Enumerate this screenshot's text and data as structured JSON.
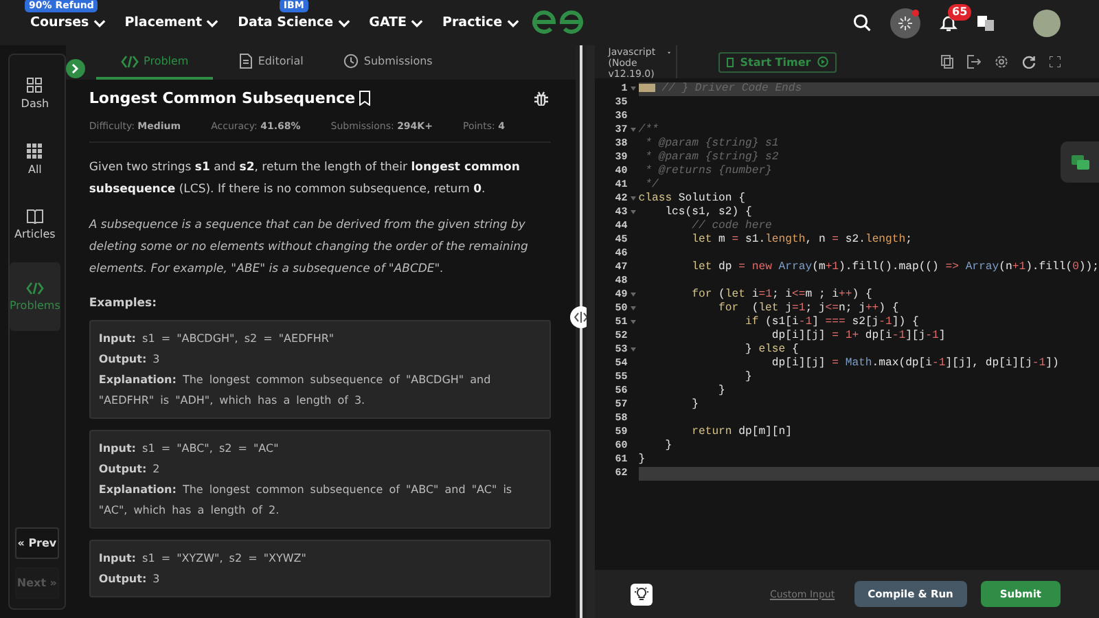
{
  "nav": {
    "items": [
      {
        "label": "Courses",
        "badge": "90% Refund"
      },
      {
        "label": "Placement"
      },
      {
        "label": "Data Science",
        "badge": "IBM"
      },
      {
        "label": "GATE"
      },
      {
        "label": "Practice"
      }
    ],
    "notifications": "65"
  },
  "sidebar": {
    "items": [
      {
        "label": "Dash",
        "kind": "dash",
        "selected": false
      },
      {
        "label": "All",
        "kind": "grid",
        "selected": false
      },
      {
        "label": "Articles",
        "kind": "book",
        "selected": false
      },
      {
        "label": "Problems",
        "kind": "code",
        "selected": true
      }
    ],
    "prev": {
      "label": "« Prev",
      "disabled": false
    },
    "next": {
      "label": "Next »",
      "disabled": true
    }
  },
  "problem_tabs": [
    {
      "label": "Problem",
      "kind": "code",
      "selected": true
    },
    {
      "label": "Editorial",
      "kind": "doc",
      "selected": false
    },
    {
      "label": "Submissions",
      "kind": "clock",
      "selected": false
    }
  ],
  "problem": {
    "title": "Longest Common Subsequence",
    "meta": [
      "Difficulty: **Medium**",
      "Accuracy: **41.68%**",
      "Submissions: **294K+**",
      "Points: **4**"
    ],
    "description": "Given two strings **s1** and **s2**, return the length of their **longest common subsequence** (LCS). If there is no common subsequence, return **0**.",
    "note": "A subsequence is a sequence that can be derived from the given string by deleting some or no elements without changing the order of the remaining elements. For example, \"ABE\" is a subsequence of \"ABCDE\".",
    "examples_heading": "Examples:",
    "examples": [
      {
        "lines": [
          "**Input:** s1 = \"ABCDGH\", s2 = \"AEDFHR\"",
          "**Output:** 3",
          "**Explanation:** The longest common subsequence of \"ABCDGH\" and \"AEDFHR\" is \"ADH\", which has a length of 3."
        ]
      },
      {
        "lines": [
          "**Input:** s1 = \"ABC\", s2 = \"AC\"",
          "**Output:** 2",
          "**Explanation:** The longest common subsequence of \"ABC\" and \"AC\" is \"AC\", which has a length of 2."
        ]
      },
      {
        "lines": [
          "**Input:** s1 = \"XYZW\", s2 = \"XYWZ\"",
          "**Output:** 3"
        ]
      }
    ]
  },
  "editor": {
    "language": "Javascript (Node v12.19.0)",
    "timer_button": "Start Timer",
    "lines": [
      {
        "number": "1",
        "foldable": true,
        "highlighted": true,
        "folded": true,
        "tokens": [
          {
            "kind": "comment",
            "text": " // } Driver Code Ends"
          }
        ]
      },
      {
        "number": "35",
        "foldable": false,
        "highlighted": false
      },
      {
        "number": "36",
        "foldable": false,
        "highlighted": false
      },
      {
        "number": "37",
        "foldable": true,
        "highlighted": false,
        "tokens": [
          {
            "kind": "comment",
            "text": "/**"
          }
        ]
      },
      {
        "number": "38",
        "foldable": false,
        "highlighted": false,
        "tokens": [
          {
            "kind": "comment",
            "text": " * @param {string} s1"
          }
        ]
      },
      {
        "number": "39",
        "foldable": false,
        "highlighted": false,
        "tokens": [
          {
            "kind": "comment",
            "text": " * @param {string} s2"
          }
        ]
      },
      {
        "number": "40",
        "foldable": false,
        "highlighted": false,
        "tokens": [
          {
            "kind": "comment",
            "text": " * @returns {number}"
          }
        ]
      },
      {
        "number": "41",
        "foldable": false,
        "highlighted": false,
        "tokens": [
          {
            "kind": "comment",
            "text": " */"
          }
        ]
      },
      {
        "number": "42",
        "foldable": true,
        "highlighted": false,
        "tokens": [
          {
            "kind": "keyword",
            "text": "class"
          },
          {
            "kind": "plain",
            "text": " Solution {"
          }
        ]
      },
      {
        "number": "43",
        "foldable": true,
        "highlighted": false,
        "tokens": [
          {
            "kind": "plain",
            "text": "    lcs(s1, s2) {"
          }
        ]
      },
      {
        "number": "44",
        "foldable": false,
        "highlighted": false,
        "tokens": [
          {
            "kind": "comment",
            "text": "        // code here"
          }
        ]
      },
      {
        "number": "45",
        "foldable": false,
        "highlighted": false,
        "tokens": [
          {
            "kind": "keyword",
            "text": "        let"
          },
          {
            "kind": "plain",
            "text": " m "
          },
          {
            "kind": "operator",
            "text": "="
          },
          {
            "kind": "plain",
            "text": " s1."
          },
          {
            "kind": "property",
            "text": "length"
          },
          {
            "kind": "plain",
            "text": ", n "
          },
          {
            "kind": "operator",
            "text": "="
          },
          {
            "kind": "plain",
            "text": " s2."
          },
          {
            "kind": "property",
            "text": "length"
          },
          {
            "kind": "plain",
            "text": ";"
          }
        ]
      },
      {
        "number": "46",
        "foldable": false,
        "highlighted": false
      },
      {
        "number": "47",
        "foldable": false,
        "highlighted": false,
        "tokens": [
          {
            "kind": "keyword",
            "text": "        let"
          },
          {
            "kind": "plain",
            "text": " dp "
          },
          {
            "kind": "operator",
            "text": "= new "
          },
          {
            "kind": "builtin",
            "text": "Array"
          },
          {
            "kind": "plain",
            "text": "(m"
          },
          {
            "kind": "operator",
            "text": "+"
          },
          {
            "kind": "number",
            "text": "1"
          },
          {
            "kind": "plain",
            "text": ").fill().map(() "
          },
          {
            "kind": "operator",
            "text": "=>"
          },
          {
            "kind": "builtin",
            "text": " Array"
          },
          {
            "kind": "plain",
            "text": "(n"
          },
          {
            "kind": "operator",
            "text": "+"
          },
          {
            "kind": "number",
            "text": "1"
          },
          {
            "kind": "plain",
            "text": ").fill("
          },
          {
            "kind": "number",
            "text": "0"
          },
          {
            "kind": "plain",
            "text": "));"
          }
        ]
      },
      {
        "number": "48",
        "foldable": false,
        "highlighted": false
      },
      {
        "number": "49",
        "foldable": true,
        "highlighted": false,
        "tokens": [
          {
            "kind": "keyword",
            "text": "        for"
          },
          {
            "kind": "plain",
            "text": " ("
          },
          {
            "kind": "keyword",
            "text": "let"
          },
          {
            "kind": "plain",
            "text": " i"
          },
          {
            "kind": "operator",
            "text": "="
          },
          {
            "kind": "number",
            "text": "1"
          },
          {
            "kind": "plain",
            "text": "; i"
          },
          {
            "kind": "operator",
            "text": "<="
          },
          {
            "kind": "plain",
            "text": "m ; i"
          },
          {
            "kind": "operator",
            "text": "++"
          },
          {
            "kind": "plain",
            "text": ") {"
          }
        ]
      },
      {
        "number": "50",
        "foldable": true,
        "highlighted": false,
        "tokens": [
          {
            "kind": "keyword",
            "text": "            for"
          },
          {
            "kind": "plain",
            "text": "  ("
          },
          {
            "kind": "keyword",
            "text": "let"
          },
          {
            "kind": "plain",
            "text": " j"
          },
          {
            "kind": "operator",
            "text": "="
          },
          {
            "kind": "number",
            "text": "1"
          },
          {
            "kind": "plain",
            "text": "; j"
          },
          {
            "kind": "operator",
            "text": "<="
          },
          {
            "kind": "plain",
            "text": "n; j"
          },
          {
            "kind": "operator",
            "text": "++"
          },
          {
            "kind": "plain",
            "text": ") {"
          }
        ]
      },
      {
        "number": "51",
        "foldable": true,
        "highlighted": false,
        "tokens": [
          {
            "kind": "keyword",
            "text": "                if"
          },
          {
            "kind": "plain",
            "text": " (s1[i"
          },
          {
            "kind": "operator",
            "text": "-"
          },
          {
            "kind": "number",
            "text": "1"
          },
          {
            "kind": "plain",
            "text": "] "
          },
          {
            "kind": "operator",
            "text": "==="
          },
          {
            "kind": "plain",
            "text": " s2[j"
          },
          {
            "kind": "operator",
            "text": "-"
          },
          {
            "kind": "number",
            "text": "1"
          },
          {
            "kind": "plain",
            "text": "]) {"
          }
        ]
      },
      {
        "number": "52",
        "foldable": false,
        "highlighted": false,
        "tokens": [
          {
            "kind": "plain",
            "text": "                    dp[i][j] "
          },
          {
            "kind": "operator",
            "text": "= "
          },
          {
            "kind": "number",
            "text": "1"
          },
          {
            "kind": "operator",
            "text": "+"
          },
          {
            "kind": "plain",
            "text": " dp[i"
          },
          {
            "kind": "operator",
            "text": "-"
          },
          {
            "kind": "number",
            "text": "1"
          },
          {
            "kind": "plain",
            "text": "][j"
          },
          {
            "kind": "operator",
            "text": "-"
          },
          {
            "kind": "number",
            "text": "1"
          },
          {
            "kind": "plain",
            "text": "]"
          }
        ]
      },
      {
        "number": "53",
        "foldable": true,
        "highlighted": false,
        "tokens": [
          {
            "kind": "plain",
            "text": "                } "
          },
          {
            "kind": "keyword",
            "text": "else"
          },
          {
            "kind": "plain",
            "text": " {"
          }
        ]
      },
      {
        "number": "54",
        "foldable": false,
        "highlighted": false,
        "tokens": [
          {
            "kind": "plain",
            "text": "                    dp[i][j] "
          },
          {
            "kind": "operator",
            "text": "= "
          },
          {
            "kind": "builtin",
            "text": "Math"
          },
          {
            "kind": "plain",
            "text": ".max(dp[i"
          },
          {
            "kind": "operator",
            "text": "-"
          },
          {
            "kind": "number",
            "text": "1"
          },
          {
            "kind": "plain",
            "text": "][j], dp[i][j"
          },
          {
            "kind": "operator",
            "text": "-"
          },
          {
            "kind": "number",
            "text": "1"
          },
          {
            "kind": "plain",
            "text": "])"
          }
        ]
      },
      {
        "number": "55",
        "foldable": false,
        "highlighted": false,
        "tokens": [
          {
            "kind": "plain",
            "text": "                }"
          }
        ]
      },
      {
        "number": "56",
        "foldable": false,
        "highlighted": false,
        "tokens": [
          {
            "kind": "plain",
            "text": "            }"
          }
        ]
      },
      {
        "number": "57",
        "foldable": false,
        "highlighted": false,
        "tokens": [
          {
            "kind": "plain",
            "text": "        }"
          }
        ]
      },
      {
        "number": "58",
        "foldable": false,
        "highlighted": false
      },
      {
        "number": "59",
        "foldable": false,
        "highlighted": false,
        "tokens": [
          {
            "kind": "keyword",
            "text": "        return"
          },
          {
            "kind": "plain",
            "text": " dp[m][n]"
          }
        ]
      },
      {
        "number": "60",
        "foldable": false,
        "highlighted": false,
        "tokens": [
          {
            "kind": "plain",
            "text": "    }"
          }
        ]
      },
      {
        "number": "61",
        "foldable": false,
        "highlighted": false,
        "tokens": [
          {
            "kind": "plain",
            "text": "}"
          }
        ]
      },
      {
        "number": "62",
        "foldable": false,
        "highlighted": true
      }
    ],
    "custom_input": "Custom Input",
    "compile_button": "Compile & Run",
    "submit_button": "Submit"
  }
}
